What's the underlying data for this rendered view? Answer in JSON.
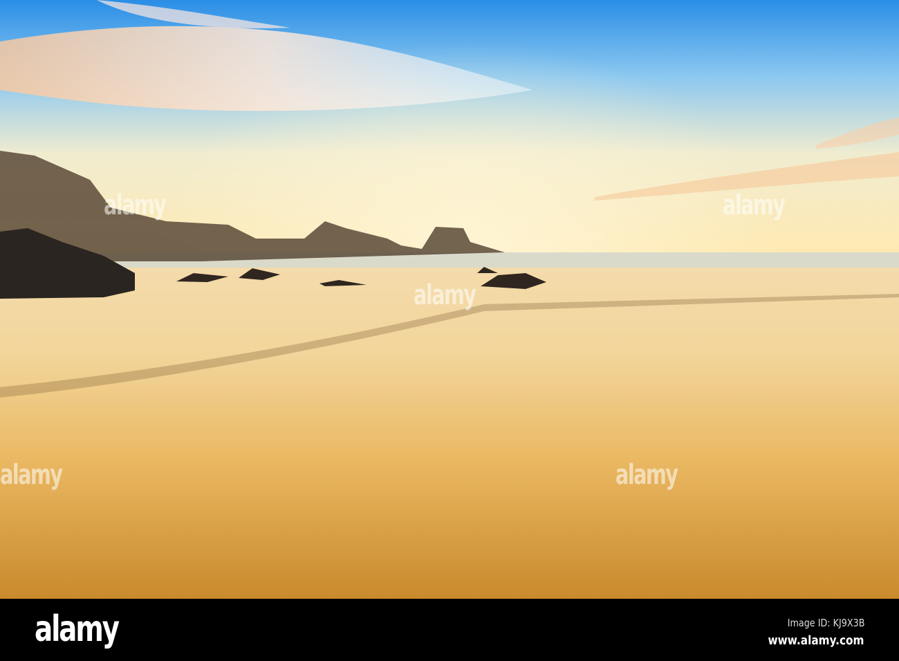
{
  "watermark": {
    "text": "alamy",
    "mark": "a"
  },
  "footer": {
    "logo": "alamy",
    "image_id": "Image ID: KJ9X3B",
    "site": "www.alamy.com"
  },
  "colors": {
    "sky_top": "#2f8fe0",
    "horizon": "#fff2c0",
    "sand": "#e0a040",
    "footer_bg": "#000000"
  }
}
